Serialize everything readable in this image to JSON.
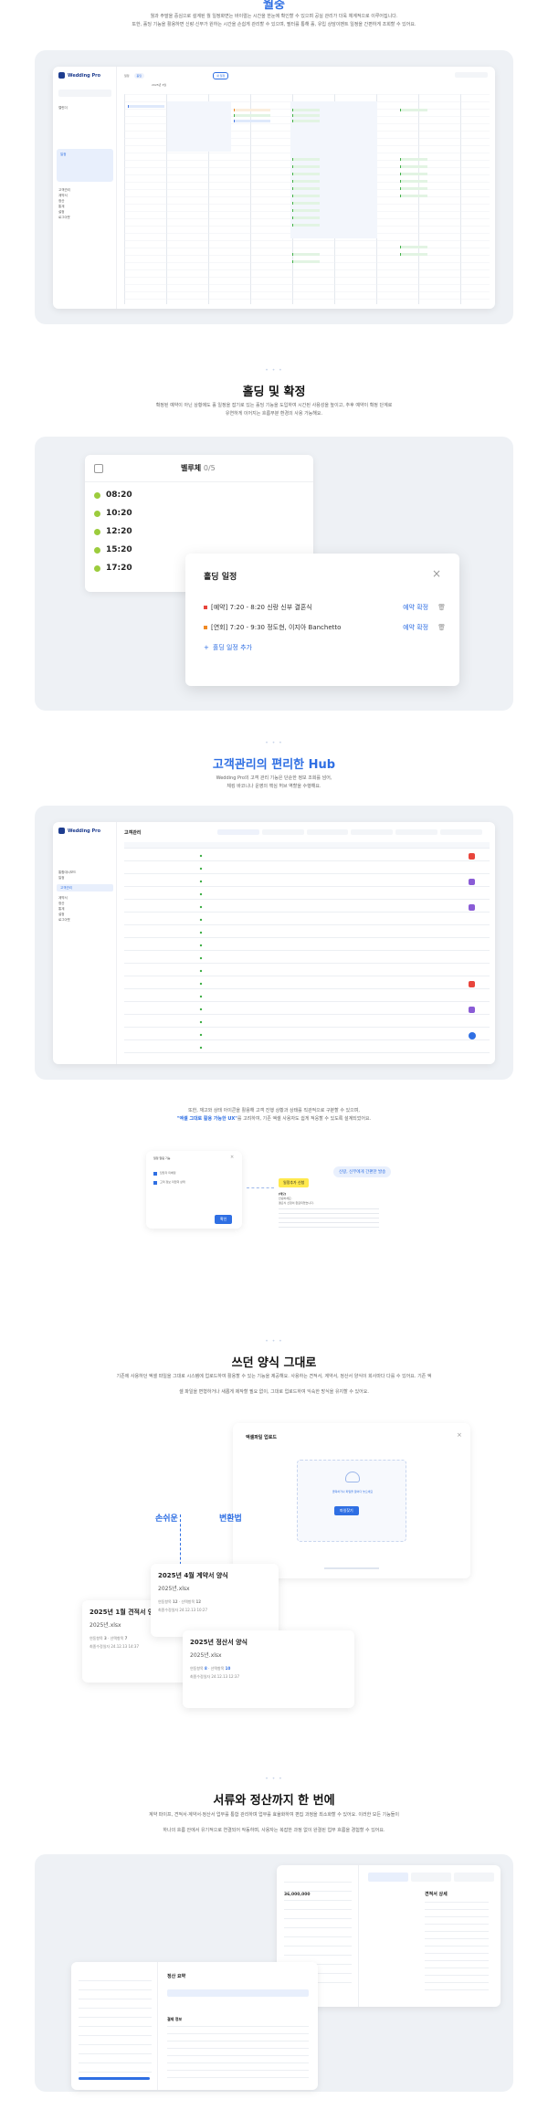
{
  "section1": {
    "title": "월중",
    "desc1": "월과 주말을 중심으로 설계된 월 일정화면는 바이럴는 시간을 한눈에 확인할 수 있으며 공실 관리가 더욱 체계적으로 이루어집니다.",
    "desc2": "또한, 홀딩 기능을 활용하면 신랑·신부가 원하는 시간을 손쉽게 관리할 수 있으며, 필터를 통해 홀, 유입 상담이벤트 일정을 간편하게 조회할 수 있어요."
  },
  "app1": {
    "logo": "Wedding Pro",
    "sidebar_items": [
      "캘린더",
      "일정",
      "고객관리",
      "계약서",
      "정산",
      "통계",
      "설정",
      "로그아웃"
    ],
    "toolbar_date": "2025년 3월",
    "tab_label": "일정",
    "tab_active": "홀딩",
    "new_btn": "새 일정"
  },
  "section2": {
    "title": "홀딩 및 확정",
    "desc1": "확정된 예약이 아닌 상황에도 홀 일정을 잡기로 있는 홀딩 기능을 도입하여 시간된 사용성을 높이고, 추후 예약이 확정 단계로",
    "desc2": "유연하게 이어지는 흐름부분 환경의 사용 가능해요."
  },
  "holdcard": {
    "header_title": "벨루체",
    "header_count": "0/5",
    "times": [
      "08:20",
      "10:20",
      "12:20",
      "15:20",
      "17:20"
    ]
  },
  "holdmodal": {
    "title": "홀딩 일정",
    "rows": [
      {
        "text": "[예약] 7:20 - 8:20  신랑 신부 결혼식",
        "action": "예약 확정",
        "color": "#e8453c"
      },
      {
        "text": "[연회] 7:20 - 9:30  정도현, 이지아  Banchetto",
        "action": "예약 확정",
        "color": "#f08a24"
      }
    ],
    "add_label": "홀딩 일정 추가"
  },
  "section3": {
    "title": "고객관리의 편리한 Hub",
    "desc1": "Wedding Pro의 고객 관리 기능은 단순한 정보 조회를 넘어,",
    "desc2": "체킹 바코니나 운영의 핵심 허브 역할을 수행해요."
  },
  "app2": {
    "logo": "Wedding Pro",
    "title": "고객관리",
    "sidebar_items": [
      "통합대시보드",
      "일정",
      "고객관리",
      "계약서",
      "정산",
      "통계",
      "설정",
      "로그아웃"
    ]
  },
  "section3b": {
    "desc1": "또한, 재고와 상태 아이콘을 활용해 고객 진행 상황과 상태를 직관적으로 구분할 수 있으며,",
    "highlight": "\"엑셀 그대로 활용 가능한 UX\"",
    "desc2": "를 고려하여, 기존 엑셀 사용자도 쉽게 적응할 수 있도록 설계되었어요."
  },
  "popup": {
    "title": "일정 알림 기능",
    "checkbox1": "담당자 미배정",
    "checkbox2": "고객 정보 미입력 상태",
    "btn": "확인",
    "tooltip_label": "일정추가 신청",
    "bubble": "신랑, 신부에게 간편한 발송",
    "memo_head": "[메모]",
    "memo_lines": [
      "안녕하세요.",
      "결혼식 신청이 완료되었습니다."
    ]
  },
  "section4": {
    "title": "쓰던 양식 그대로",
    "desc1": "기존에 사용하던 엑셀 파일을 그대로 시스템에 업로드하여 활용할 수 있는 기능을 제공해요. 사용하는 견적서, 계약서, 정산서 양식이 회사마다 다를 수 있어요. 기존 엑",
    "desc2": "셀 파일을 변형하거나 새롭게 제작할 필요 없이, 그대로 업로드하여 익숙한 방식을 유지할 수 있어요.",
    "left_label": "손쉬운",
    "right_label": "변환법"
  },
  "upload": {
    "title": "엑셀파일 업로드",
    "hint": "클릭하거나 파일을 끌어다 놓으세요",
    "btn": "파일찾기"
  },
  "files": [
    {
      "title": "2025년 4월 계약서 양식",
      "name": "2025년.xlsx",
      "count_a": "12",
      "count_b": "12",
      "date": "24.12.13  10:27"
    },
    {
      "title": "2025년 1월 견적서 양식",
      "name": "2025년.xlsx",
      "count_a": "3",
      "count_b": "7",
      "date": "24.12.13  14:37"
    },
    {
      "title": "2025년 정산서 양식",
      "name": "2025년.xlsx",
      "count_a": "8",
      "count_b": "10",
      "date": "24.12.13  12:37"
    }
  ],
  "file_labels": {
    "a": "연동항목",
    "b": "선택항목",
    "date": "최종수정일자"
  },
  "section5": {
    "title": "서류와 정산까지 한 번에",
    "desc1": "계약 파이프, 견적서·계약서·정산서 업무를 통합 관리하며 업무를 효율화하여 편집 과정을 최소화할 수 있어요. 이러한 모든 기능들이",
    "desc2": "하나의 흐름 안에서 유기적으로 연결되어 작동하며, 사용자는 복잡한 과정 없이 완결된 업무 흐름을 경험할 수 있어요."
  },
  "doc": {
    "estimate_title": "견적서 상세",
    "amount": "36,000,000",
    "settle_title": "정산 요약",
    "payment_title": "결제 정보"
  },
  "colors": {
    "accent": "#2f6fe3",
    "green": "#9ccc3d",
    "red": "#e8453c",
    "orange": "#f08a24",
    "purple": "#8a5cd6"
  }
}
